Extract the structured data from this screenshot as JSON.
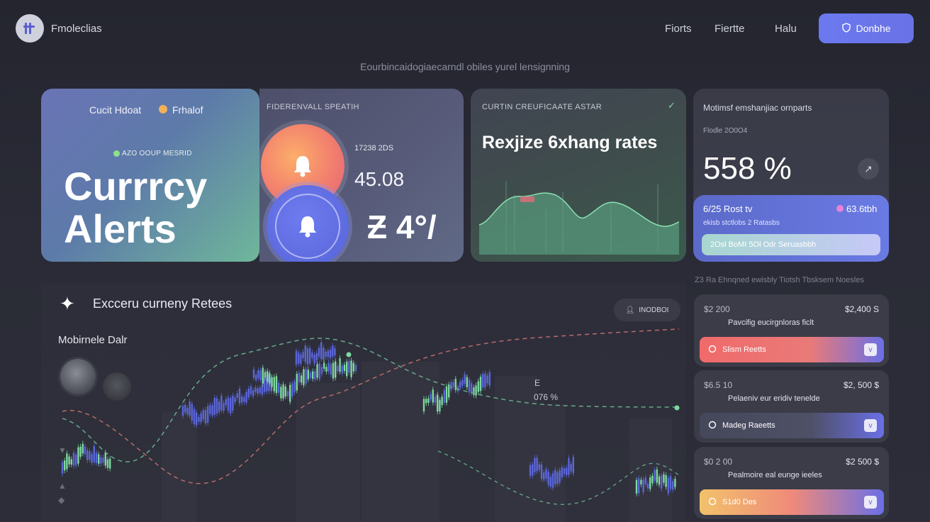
{
  "header": {
    "brand": "Fmoleclias",
    "nav": [
      "Fiorts",
      "Fiertte",
      "Halu"
    ],
    "cta_label": "Donbhe",
    "subtitle": "Eourbincaidogiaecarndl obiles yurel lensignning"
  },
  "hero": {
    "tag_left": "Cucit Hdoat",
    "tag_right": "Frhalof",
    "chip": "AZO OOUP MESRID",
    "title_line1": "Currrcy",
    "title_line2": "Alerts"
  },
  "bells_card": {
    "heading": "FIDERENVALL SPEATIH",
    "small": "17238 2DS",
    "value": "45.08",
    "big": "Ƶ 4°/"
  },
  "rates_card": {
    "heading": "CURTIN CREUFICAATE ASTAR",
    "check": "✓",
    "title": "Rexjize 6xhang rates"
  },
  "pct_card": {
    "heading": "Motimsf emshanjiac ornparts",
    "sub": "Flodle 2O0O4",
    "value": "558 %",
    "arrow": "↗",
    "row1_left": "6/25 Rost tv",
    "row1_right": "63.6tbh",
    "row2": "ekisb stctlobs   2 Ratasbs",
    "bar_label": "2Osl BoMI 5Ol Odr Seruasbbh"
  },
  "main": {
    "title": "Excceru curneny Retees",
    "mobile_label": "Mobirnele  Dalr",
    "pill_label": "INODBOI",
    "label1": "E",
    "label2": "076 %"
  },
  "list": {
    "heading": "Z3 Ra Ehnqned ewisbly Tiotsh Tbsksem Noesles",
    "cards": [
      {
        "left": "$2 200",
        "right": "$2,400 S",
        "mid": "Pavcifig eucirgnloras ficlt",
        "bar": "Slism Reetts",
        "chev": "v"
      },
      {
        "left": "$6.5 10",
        "right": "$2, 500 $",
        "mid": "Pelaeniv eur eridiv tenelde",
        "bar": "Madeg Raeetts",
        "chev": "v"
      },
      {
        "left": "$0 2 00",
        "right": "$2 500 $",
        "mid": "Pealmoire eal eunge ieeles",
        "bar": "S1d0 Des",
        "chev": "v"
      }
    ]
  },
  "colors": {
    "accent": "#6b79ef",
    "hero_start": "#6a74b6",
    "hero_end": "#6fb79a",
    "up": "#7ed8a0",
    "down": "#5b66d9",
    "alert_orange": "#f27e6e"
  },
  "icons": [
    "logo-icon",
    "shield-icon",
    "bell-icon",
    "check-icon",
    "arrow-icon",
    "sparkle-icon",
    "user-icon",
    "chevron-down-icon"
  ]
}
